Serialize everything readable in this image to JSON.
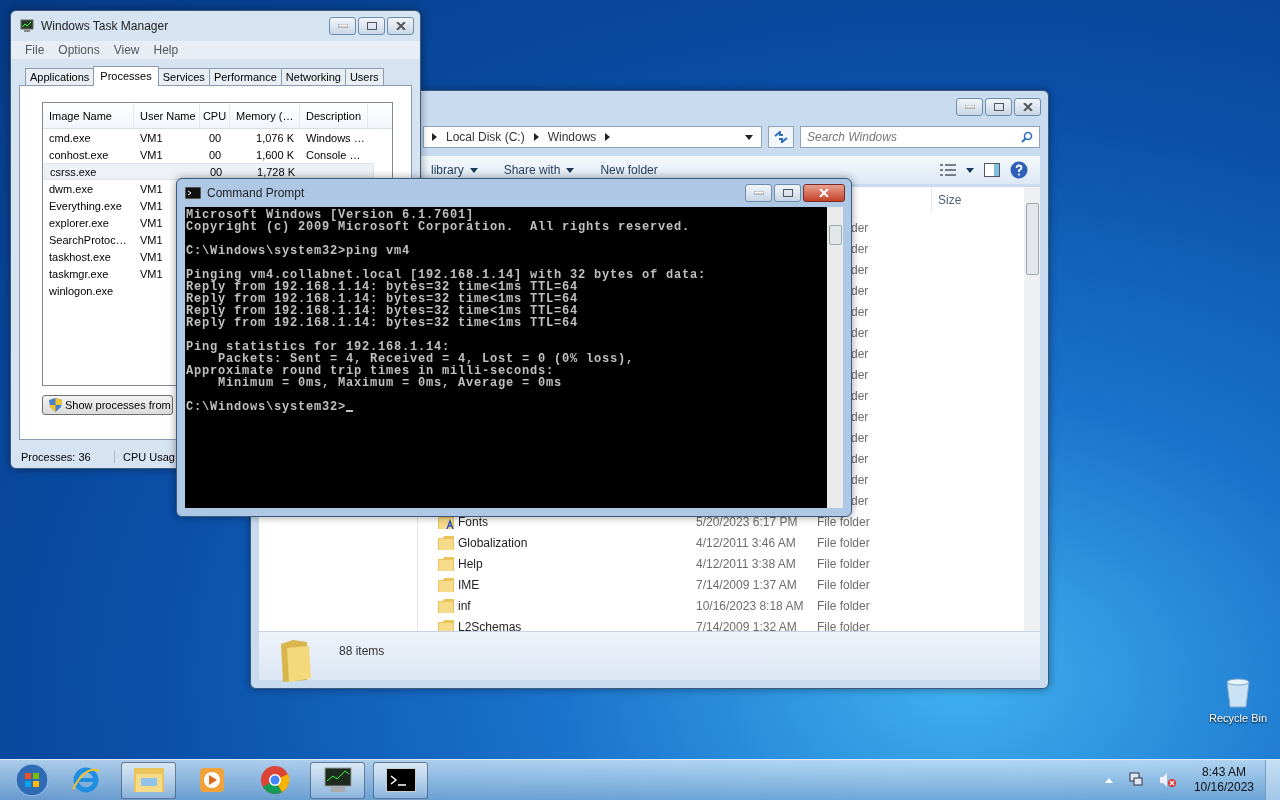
{
  "desktop": {
    "icons": [
      {
        "label": "Recycle Bin"
      }
    ]
  },
  "task_manager": {
    "title": "Windows Task Manager",
    "menu": [
      "File",
      "Options",
      "View",
      "Help"
    ],
    "tabs": [
      {
        "label": "Applications",
        "selected": false
      },
      {
        "label": "Processes",
        "selected": true
      },
      {
        "label": "Services",
        "selected": false
      },
      {
        "label": "Performance",
        "selected": false
      },
      {
        "label": "Networking",
        "selected": false
      },
      {
        "label": "Users",
        "selected": false
      }
    ],
    "columns": [
      "Image Name",
      "User Name",
      "CPU",
      "Memory (…",
      "Description"
    ],
    "rows": [
      {
        "image": "cmd.exe",
        "user": "VM1",
        "cpu": "00",
        "memory": "1,076 K",
        "description": "Windows …",
        "selected": false
      },
      {
        "image": "conhost.exe",
        "user": "VM1",
        "cpu": "00",
        "memory": "1,600 K",
        "description": "Console …",
        "selected": false
      },
      {
        "image": "csrss.exe",
        "cpu": "00",
        "memory": "1,728 K",
        "selected": true
      },
      {
        "image": "dwm.exe",
        "user": "VM1",
        "selected": false
      },
      {
        "image": "Everything.exe",
        "user": "VM1",
        "selected": false
      },
      {
        "image": "explorer.exe",
        "user": "VM1",
        "selected": false
      },
      {
        "image": "SearchProtoc…",
        "user": "VM1",
        "selected": false
      },
      {
        "image": "taskhost.exe",
        "user": "VM1",
        "selected": false
      },
      {
        "image": "taskmgr.exe",
        "user": "VM1",
        "selected": false
      },
      {
        "image": "winlogon.exe",
        "selected": false
      }
    ],
    "button": "Show processes from",
    "status": [
      "Processes: 36",
      "CPU Usag"
    ]
  },
  "explorer": {
    "breadcrumb": [
      "Local Disk (C:)",
      "Windows"
    ],
    "search": {
      "placeholder": "Search Windows"
    },
    "toolbar": [
      {
        "label": "library",
        "dropdown": true
      },
      {
        "label": "Share with",
        "dropdown": true
      },
      {
        "label": "New folder",
        "dropdown": false
      }
    ],
    "columns": [
      "Size"
    ],
    "covered_rows": [
      "der",
      "der",
      "der",
      "der",
      "der",
      "der",
      "der",
      "der",
      "der",
      "der",
      "der",
      "der",
      "der",
      "der"
    ],
    "files": [
      {
        "name": "Fonts",
        "date": "5/20/2023 6:17 PM",
        "type": "File folder",
        "kind": "fonts"
      },
      {
        "name": "Globalization",
        "date": "4/12/2011 3:46 AM",
        "type": "File folder",
        "kind": "folder"
      },
      {
        "name": "Help",
        "date": "4/12/2011 3:38 AM",
        "type": "File folder",
        "kind": "folder"
      },
      {
        "name": "IME",
        "date": "7/14/2009 1:37 AM",
        "type": "File folder",
        "kind": "folder"
      },
      {
        "name": "inf",
        "date": "10/16/2023 8:18 AM",
        "type": "File folder",
        "kind": "folder"
      },
      {
        "name": "L2Schemas",
        "date": "7/14/2009 1:32 AM",
        "type": "File folder",
        "kind": "folder"
      }
    ],
    "status": "88 items"
  },
  "cmd": {
    "title": "Command Prompt",
    "blocks": [
      [
        "Microsoft Windows [Version 6.1.7601]",
        "Copyright (c) 2009 Microsoft Corporation.  All rights reserved."
      ],
      [
        "C:\\Windows\\system32>ping vm4"
      ],
      [
        "Pinging vm4.collabnet.local [192.168.1.14] with 32 bytes of data:",
        "Reply from 192.168.1.14: bytes=32 time<1ms TTL=64",
        "Reply from 192.168.1.14: bytes=32 time<1ms TTL=64",
        "Reply from 192.168.1.14: bytes=32 time<1ms TTL=64",
        "Reply from 192.168.1.14: bytes=32 time<1ms TTL=64"
      ],
      [
        "Ping statistics for 192.168.1.14:",
        "    Packets: Sent = 4, Received = 4, Lost = 0 (0% loss),",
        "Approximate round trip times in milli-seconds:",
        "    Minimum = 0ms, Maximum = 0ms, Average = 0ms"
      ],
      [
        "C:\\Windows\\system32>"
      ]
    ]
  },
  "taskbar": {
    "apps": [
      {
        "kind": "ie",
        "active": false
      },
      {
        "kind": "explorer",
        "active": true
      },
      {
        "kind": "media",
        "active": false
      },
      {
        "kind": "chrome",
        "active": false
      },
      {
        "kind": "taskmgr",
        "active": true
      },
      {
        "kind": "cmd",
        "active": true
      }
    ],
    "time": "8:43 AM",
    "date": "10/16/2023"
  }
}
